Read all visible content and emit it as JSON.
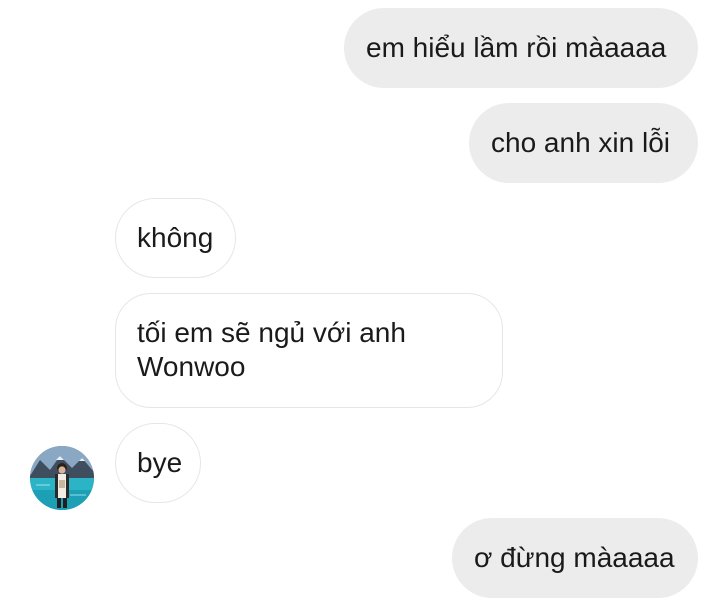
{
  "conversation": {
    "messages": [
      {
        "sender": "me",
        "text": "em hiểu lầm rồi màaaaa"
      },
      {
        "sender": "me",
        "text": "cho anh xin lỗi"
      },
      {
        "sender": "them",
        "text": "không"
      },
      {
        "sender": "them",
        "text": "tối em sẽ ngủ với anh\nWonwoo"
      },
      {
        "sender": "them",
        "text": "bye"
      },
      {
        "sender": "me",
        "text": "ơ đừng màaaaa"
      }
    ],
    "colors": {
      "sent_bubble": "#ececec",
      "received_bubble": "#ffffff",
      "received_border": "#e6e6e6",
      "text": "#1a1a1a"
    },
    "avatar_icon": "profile-photo-lake-mountains"
  }
}
